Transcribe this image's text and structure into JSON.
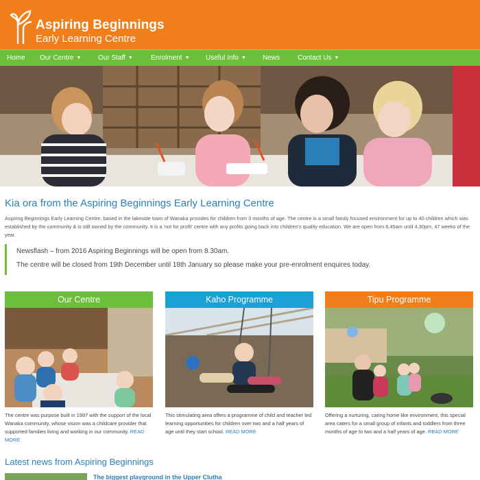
{
  "header": {
    "logo_line1": "Aspiring Beginnings",
    "logo_line2": "Early Learning Centre",
    "bg_color": "#f07f1b"
  },
  "nav": {
    "bg_color": "#6bbf3a",
    "items": [
      {
        "label": "Home",
        "has_dropdown": false
      },
      {
        "label": "Our Centre",
        "has_dropdown": true
      },
      {
        "label": "Our Staff",
        "has_dropdown": true
      },
      {
        "label": "Enrolment",
        "has_dropdown": true
      },
      {
        "label": "Useful Info",
        "has_dropdown": true
      },
      {
        "label": "News",
        "has_dropdown": false
      },
      {
        "label": "Contact Us",
        "has_dropdown": true
      }
    ],
    "caret": "▼"
  },
  "intro": {
    "title": "Kia ora from the Aspiring Beginnings Early Learning Centre",
    "text": "Aspiring Beginnings Early Learning Centre, based in the lakeside town of Wanaka provides for children from 3 months of age. The centre is a small family focused environment for up to 40 children which was established by the community & is still owned by the community. It is a  'not for profit' centre with any profits going back into children's quality education. We are open from 8.45am until 4.30pm, 47 weeks of the year."
  },
  "newsflash": {
    "line1": "Newsflash – from 2016 Aspiring Beginnings will be open from 8.30am.",
    "line2": "The centre will be closed from 19th December until 18th January so please make your pre-enrolment enquires today."
  },
  "cards": [
    {
      "title": "Our Centre",
      "color": "#6bbf3a",
      "text": "The centre was purpose built in 1997 with the support of the local Wanaka community, whose vision was a childcare provider that supported families living and working in our community.",
      "read_more": "READ MORE"
    },
    {
      "title": "Kaho Programme",
      "color": "#1aa1d6",
      "text": "This stimulating area offers a programme of child and teacher led learning opportunities for children over two and a half years of age until they start school.",
      "read_more": "READ MORE"
    },
    {
      "title": "Tipu Programme",
      "color": "#f07f1b",
      "text": "Offering a nurturing, caring home like environment, this special area caters for a small group of infants and toddlers from three months of age to two and a half years of age.",
      "read_more": "READ MORE"
    }
  ],
  "latest": {
    "title": "Latest news from Aspiring Beginnings",
    "first_item": "The biggest playground in the Upper Clutha"
  },
  "colors": {
    "link": "#2a7fb8",
    "accent_orange": "#f07f1b",
    "accent_green": "#6bbf3a",
    "accent_blue": "#1aa1d6"
  }
}
